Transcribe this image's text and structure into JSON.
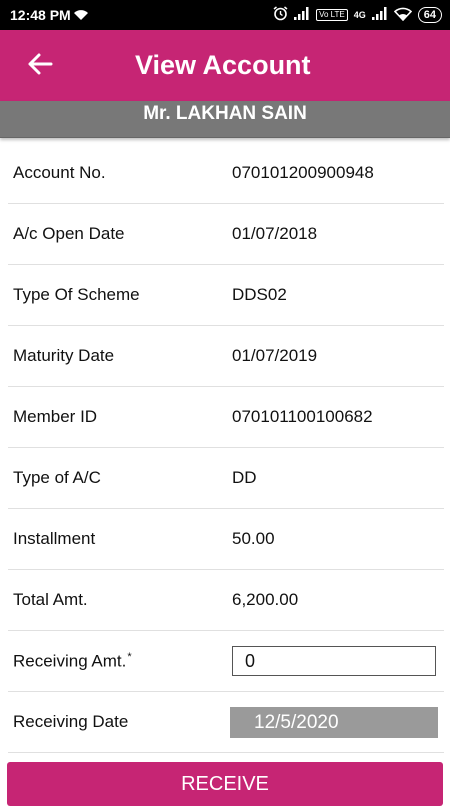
{
  "status_bar": {
    "time": "12:48 PM",
    "battery": "64",
    "volte": "Vo LTE",
    "network": "4G"
  },
  "header": {
    "title": "View Account",
    "back_icon": "arrow-left-icon",
    "color": "#c62574"
  },
  "customer_name": "Mr. LAKHAN SAIN",
  "fields": [
    {
      "label": "Account No.",
      "value": "070101200900948"
    },
    {
      "label": "A/c Open Date",
      "value": "01/07/2018"
    },
    {
      "label": "Type Of Scheme",
      "value": "DDS02"
    },
    {
      "label": "Maturity Date",
      "value": "01/07/2019"
    },
    {
      "label": "Member ID",
      "value": "070101100100682"
    },
    {
      "label": "Type of A/C",
      "value": "DD"
    },
    {
      "label": "Installment",
      "value": "50.00"
    },
    {
      "label": "Total Amt.",
      "value": "6,200.00"
    }
  ],
  "receiving_amount": {
    "label": "Receiving Amt.",
    "required_mark": "*",
    "value": "0"
  },
  "receiving_date": {
    "label": "Receiving Date",
    "value": "12/5/2020"
  },
  "receive_button": {
    "label": "RECEIVE"
  }
}
